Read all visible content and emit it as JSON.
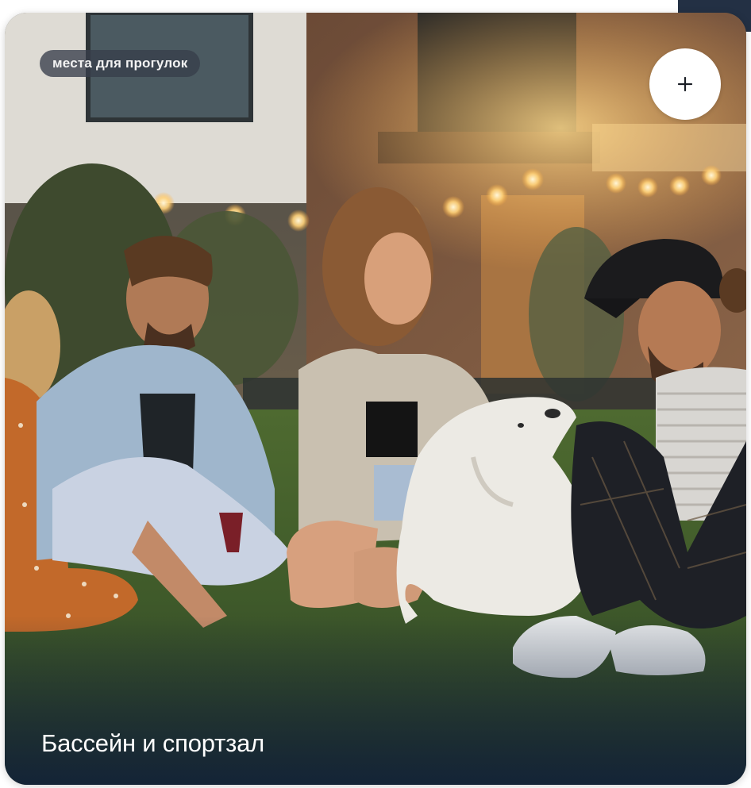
{
  "card": {
    "tag_label": "места для прогулок",
    "add_button_icon": "plus-icon",
    "title": "Бассейн и спортзал",
    "image_alt": "Friends sitting on the lawn with a white dog"
  },
  "colors": {
    "tag_background": "#373e4a",
    "corner_accent": "#233044",
    "title_text": "#ffffff"
  }
}
